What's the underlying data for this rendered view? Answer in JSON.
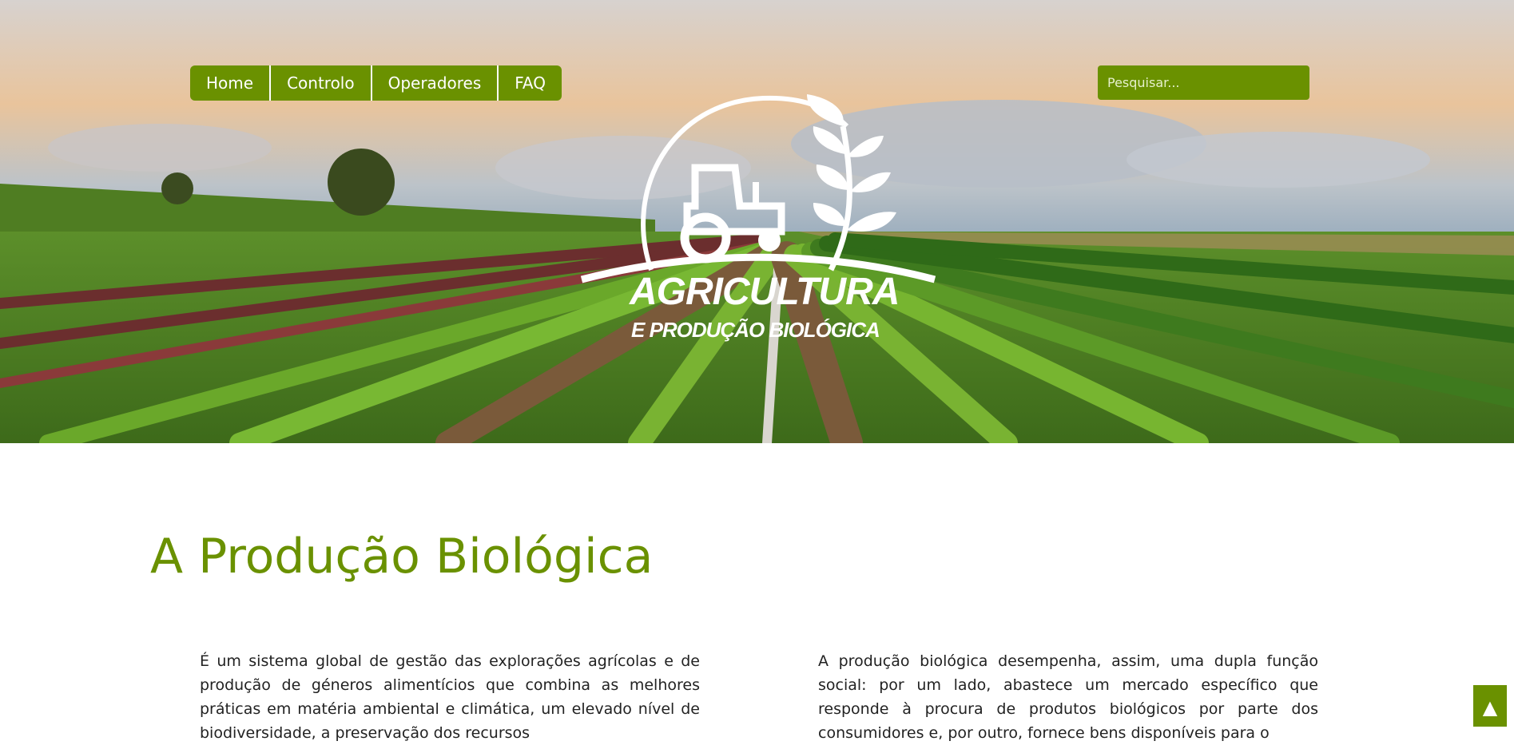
{
  "nav": {
    "items": [
      {
        "label": "Home"
      },
      {
        "label": "Controlo"
      },
      {
        "label": "Operadores"
      },
      {
        "label": "FAQ"
      }
    ]
  },
  "search": {
    "placeholder": "Pesquisar..."
  },
  "logo": {
    "title": "AGRICULTURA",
    "subtitle": "E PRODUÇÃO BIOLÓGICA"
  },
  "main": {
    "heading": "A Produção Biológica",
    "left_paragraph": "É um sistema global de gestão das explorações agrícolas e de produção de géneros alimentícios que combina as melhores práticas em matéria ambiental e climática, um elevado nível de biodiversidade, a preservação dos recursos",
    "right_paragraph": "A produção biológica desempenha, assim, uma dupla função social: por um lado, abastece um mercado específico que responde à procura de produtos biológicos por parte dos consumidores e, por outro, fornece bens disponíveis para o"
  },
  "back_to_top": {
    "icon": "▲"
  },
  "colors": {
    "accent": "#6a9100"
  }
}
